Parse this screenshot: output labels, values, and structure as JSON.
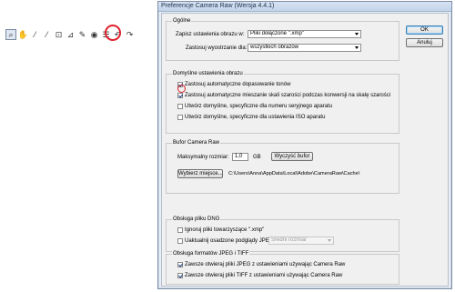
{
  "toolbar": {
    "tools": [
      "zoom-tool",
      "hand-tool",
      "white-balance-tool",
      "color-sampler-tool",
      "crop-tool",
      "straighten-tool",
      "retouch-tool",
      "red-eye-tool",
      "preferences-tool",
      "rotate-left-tool",
      "rotate-right-tool"
    ],
    "glyphs": [
      "⌕",
      "✋",
      "⁄",
      "⁄",
      "⊡",
      "⊿",
      "✎",
      "◉",
      "☰",
      "↶",
      "↷"
    ]
  },
  "dialog": {
    "title": "Preferencje Camera Raw  (Wersja 4.4.1)",
    "ok_label": "OK",
    "cancel_label": "Anuluj",
    "general": {
      "title": "Ogólne",
      "save_label": "Zapisz ustawienia obrazu w:",
      "save_value": "Pliki dołączone \".xmp\"",
      "apply_label": "Zastosuj wyostrzanie dla:",
      "apply_value": "wszystkich obrazów"
    },
    "defaults": {
      "title": "Domyślne ustawienia obrazu",
      "opt1": "Zastosuj automatyczne dopasowanie tonów",
      "opt2": "Zastosuj automatyczne mieszanie skali szarości podczas konwersji na skalę szarości",
      "opt3": "Utwórz domyślne, specyficzne dla numeru seryjnego aparatu",
      "opt4": "Utwórz domyślne, specyficzne dla ustawienia ISO aparatu"
    },
    "cache": {
      "title": "Bufor Camera Raw",
      "max_label": "Maksymalny rozmiar:",
      "max_value": "1,0",
      "unit": "GB",
      "purge_label": "Wyczyść bufor",
      "select_label": "Wybierz miejsce...",
      "path": "C:\\Users\\Anna\\AppData\\Local\\Adobe\\CameraRaw\\Cache\\"
    },
    "dng": {
      "title": "Obsługa pliku DNG",
      "opt1": "Ignoruj pliki towarzyszące \".xmp\"",
      "opt2": "Uaktualnij osadzone podglądy JPEG:",
      "preview_value": "Średni rozmiar"
    },
    "jpeg": {
      "title": "Obsługa formatów JPEG i TIFF",
      "opt1": "Zawsze otwieraj pliki JPEG z ustawieniami używając Camera Raw",
      "opt2": "Zawsze otwieraj pliki TIFF z ustawieniami używając Camera Raw"
    }
  }
}
